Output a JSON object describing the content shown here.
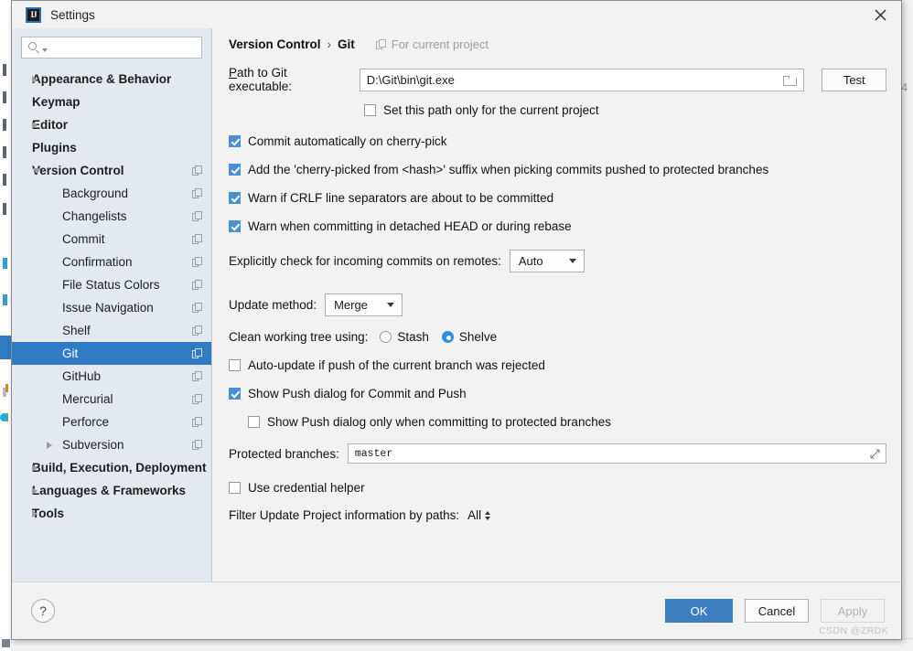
{
  "window": {
    "title": "Settings",
    "app_icon": "intellij-idea-icon",
    "close_icon": "close-icon"
  },
  "sidebar": {
    "search": {
      "placeholder": "",
      "value": "",
      "icon": "search-icon"
    },
    "items": [
      {
        "label": "Appearance & Behavior",
        "level": "top",
        "arrow": "right",
        "badge": false
      },
      {
        "label": "Keymap",
        "level": "top",
        "arrow": "none",
        "badge": false
      },
      {
        "label": "Editor",
        "level": "top",
        "arrow": "right",
        "badge": false
      },
      {
        "label": "Plugins",
        "level": "top",
        "arrow": "none",
        "badge": false
      },
      {
        "label": "Version Control",
        "level": "top",
        "arrow": "down",
        "badge": true
      },
      {
        "label": "Background",
        "level": "child",
        "arrow": "none",
        "badge": true
      },
      {
        "label": "Changelists",
        "level": "child",
        "arrow": "none",
        "badge": true
      },
      {
        "label": "Commit",
        "level": "child",
        "arrow": "none",
        "badge": true
      },
      {
        "label": "Confirmation",
        "level": "child",
        "arrow": "none",
        "badge": true
      },
      {
        "label": "File Status Colors",
        "level": "child",
        "arrow": "none",
        "badge": true
      },
      {
        "label": "Issue Navigation",
        "level": "child",
        "arrow": "none",
        "badge": true
      },
      {
        "label": "Shelf",
        "level": "child",
        "arrow": "none",
        "badge": true
      },
      {
        "label": "Git",
        "level": "child",
        "arrow": "none",
        "badge": true,
        "selected": true
      },
      {
        "label": "GitHub",
        "level": "child",
        "arrow": "none",
        "badge": true
      },
      {
        "label": "Mercurial",
        "level": "child",
        "arrow": "none",
        "badge": true
      },
      {
        "label": "Perforce",
        "level": "child",
        "arrow": "none",
        "badge": true
      },
      {
        "label": "Subversion",
        "level": "child",
        "arrow": "right",
        "badge": true
      },
      {
        "label": "Build, Execution, Deployment",
        "level": "top",
        "arrow": "right",
        "badge": false
      },
      {
        "label": "Languages & Frameworks",
        "level": "top",
        "arrow": "right",
        "badge": false
      },
      {
        "label": "Tools",
        "level": "top",
        "arrow": "right",
        "badge": false
      }
    ]
  },
  "main": {
    "breadcrumb": {
      "parent": "Version Control",
      "separator": "›",
      "current": "Git",
      "scope_note": "For current project",
      "scope_icon": "project-scope-icon"
    },
    "path": {
      "label": "Path to Git executable:",
      "value": "D:\\Git\\bin\\git.exe",
      "browse_icon": "folder-icon",
      "test_label": "Test"
    },
    "set_path_only": {
      "label": "Set this path only for the current project",
      "checked": false
    },
    "checkboxes": [
      {
        "label": "Commit automatically on cherry-pick",
        "checked": true
      },
      {
        "label": "Add the 'cherry-picked from <hash>' suffix when picking commits pushed to protected branches",
        "checked": true
      },
      {
        "label": "Warn if CRLF line separators are about to be committed",
        "checked": true
      },
      {
        "label": "Warn when committing in detached HEAD or during rebase",
        "checked": true
      }
    ],
    "incoming": {
      "label": "Explicitly check for incoming commits on remotes:",
      "value": "Auto"
    },
    "update_method": {
      "label": "Update method:",
      "value": "Merge"
    },
    "clean_tree": {
      "label": "Clean working tree using:",
      "options": [
        {
          "label": "Stash",
          "selected": false
        },
        {
          "label": "Shelve",
          "selected": true
        }
      ]
    },
    "auto_update": {
      "label": "Auto-update if push of the current branch was rejected",
      "checked": false
    },
    "show_push": {
      "label": "Show Push dialog for Commit and Push",
      "checked": true
    },
    "show_push_protected": {
      "label": "Show Push dialog only when committing to protected branches",
      "checked": false
    },
    "protected_branches": {
      "label": "Protected branches:",
      "value": "master",
      "expand_icon": "expand-icon"
    },
    "credential_helper": {
      "label": "Use credential helper",
      "checked": false
    },
    "filter_paths": {
      "label": "Filter Update Project information by paths:",
      "value": "All"
    }
  },
  "footer": {
    "help_label": "?",
    "ok_label": "OK",
    "cancel_label": "Cancel",
    "apply_label": "Apply",
    "watermark": "CSDN @ZRDK"
  },
  "background": {
    "right_char": "4",
    "bottom_text": "· · · · · · · · · · · · · · · · · · · · · · · · · · · · · · · · · · · · ·"
  },
  "colors": {
    "accent_blue": "#2f7cc4",
    "checkbox_blue": "#4a90d0",
    "radio_blue": "#2f8fdd",
    "sidebar_bg": "#e4e9ef",
    "panel_bg": "#f2f2f2"
  }
}
